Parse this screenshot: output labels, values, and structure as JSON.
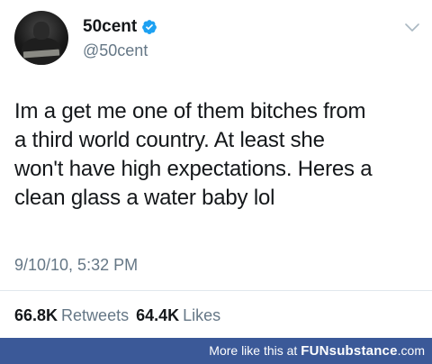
{
  "profile": {
    "display_name": "50cent",
    "handle": "@50cent",
    "verified": true,
    "avatar_icon": "profile-photo"
  },
  "tweet": {
    "text": "Im a get me one of them bitches from\na third  world country. At least she\nwon't have high expectations. Heres a\nclean glass a water baby lol",
    "timestamp": "9/10/10, 5:32 PM"
  },
  "stats": {
    "retweets_count": "66.8K",
    "retweets_label": "Retweets",
    "likes_count": "64.4K",
    "likes_label": "Likes"
  },
  "footer": {
    "prefix": "More like this at ",
    "brand": "FUNsubstance",
    "suffix": ".com"
  },
  "colors": {
    "verified_blue": "#1da1f2",
    "muted_gray": "#657786",
    "footer_blue": "#3b5998"
  }
}
